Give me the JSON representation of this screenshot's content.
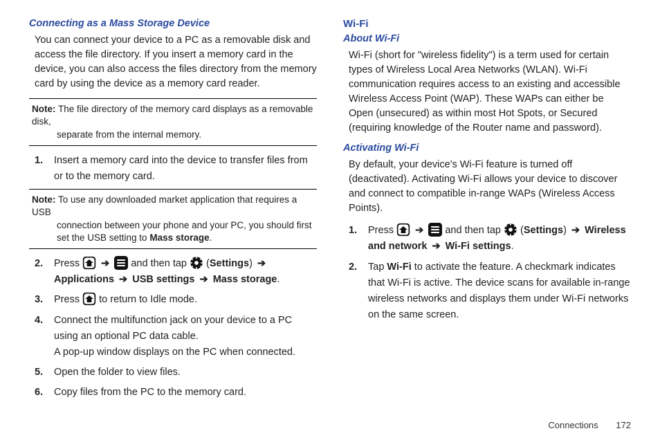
{
  "left": {
    "h1": "Connecting as a Mass Storage Device",
    "p1": "You can connect your device to a PC as a removable disk and access the file directory. If you insert a memory card in the device, you can also access the files directory from the memory card by using the device as a memory card reader.",
    "note1_label": "Note:",
    "note1_a": "The file directory of the memory card displays as a removable disk,",
    "note1_b": "separate from the internal memory.",
    "step1": "Insert a memory card into the device to transfer files from or to the memory card.",
    "note2_label": "Note:",
    "note2_a": "To use any downloaded market application that requires a USB",
    "note2_b": "connection between your phone and your PC, you should first set the USB setting to ",
    "note2_c": "Mass storage",
    "note2_d": ".",
    "step2_a": "Press ",
    "step2_b": " and then tap ",
    "step2_c_open": " (",
    "step2_c": "Settings",
    "step2_c_close": ") ",
    "step2_d": "Applications ",
    "step2_e": " USB settings ",
    "step2_f": " Mass storage",
    "step2_g": ".",
    "step3_a": "Press ",
    "step3_b": " to return to Idle mode.",
    "step4": "Connect the multifunction jack on your device to a PC using an optional PC data cable.",
    "step4b": "A pop-up window displays on the PC when connected.",
    "step5": "Open the folder to view files.",
    "step6": "Copy files from the PC to the memory card."
  },
  "right": {
    "h1": "Wi-Fi",
    "h2": "About Wi-Fi",
    "p1": "Wi-Fi (short for \"wireless fidelity\") is a term used for certain types of Wireless Local Area Networks (WLAN). Wi-Fi communication requires access to an existing and accessible Wireless Access Point (WAP). These WAPs can either be Open (unsecured) as within most Hot Spots, or Secured (requiring knowledge of the Router name and password).",
    "h3": "Activating Wi-Fi",
    "p2": "By default, your device's Wi-Fi feature is turned off (deactivated). Activating Wi-Fi allows your device to discover and connect to compatible in-range WAPs (Wireless Access Points).",
    "step1_a": "Press ",
    "step1_b": " and then tap ",
    "step1_c_open": " (",
    "step1_c": "Settings",
    "step1_c_close": ") ",
    "step1_d": "Wireless and network ",
    "step1_e": " Wi-Fi settings",
    "step1_f": ".",
    "step2_a": "Tap ",
    "step2_b": "Wi-Fi",
    "step2_c": " to activate the feature. A checkmark indicates that Wi-Fi is active. The device scans for available in-range wireless networks and displays them under Wi-Fi networks on the same screen."
  },
  "arrow": "➔",
  "footer": {
    "section": "Connections",
    "page": "172"
  }
}
